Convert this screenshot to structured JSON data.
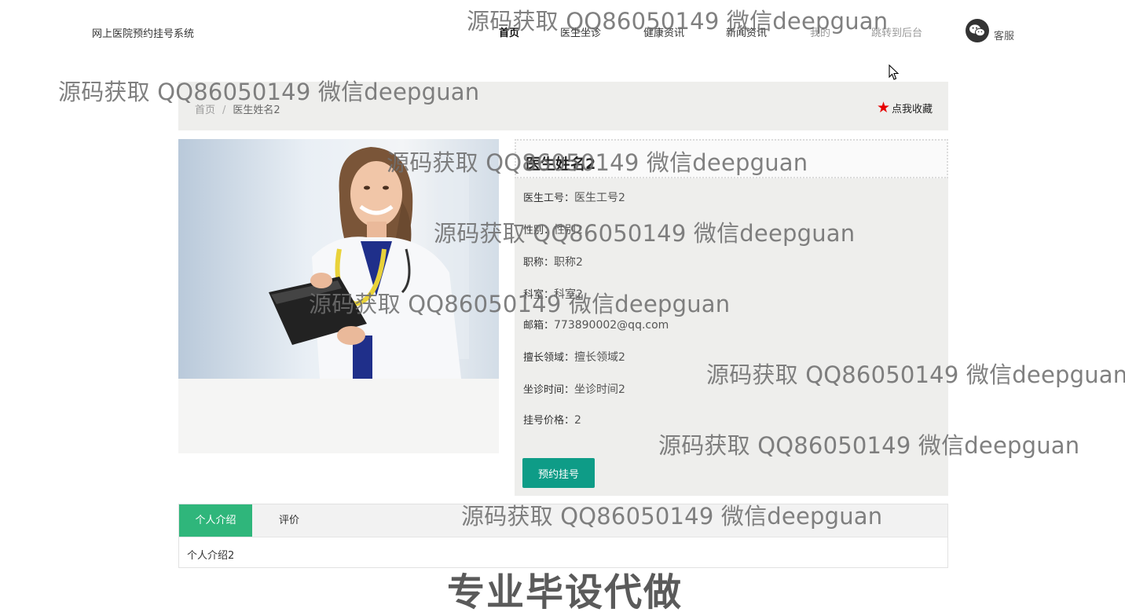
{
  "header": {
    "site_title": "网上医院预约挂号系统",
    "nav": [
      "首页",
      "医生坐诊",
      "健康资讯",
      "新闻资讯",
      "我的",
      "跳转到后台"
    ],
    "customer_service": "客服"
  },
  "breadcrumb": {
    "home": "首页",
    "separator": "/",
    "current": "医生姓名2"
  },
  "favorite_label": "点我收藏",
  "doctor": {
    "name": "医生姓名2",
    "fields": [
      {
        "label": "医生工号：",
        "value": "医生工号2"
      },
      {
        "label": "性别：",
        "value": "性别2"
      },
      {
        "label": "职称：",
        "value": "职称2"
      },
      {
        "label": "科室：",
        "value": "科室2"
      },
      {
        "label": "邮箱：",
        "value": "773890002@qq.com"
      },
      {
        "label": "擅长领域：",
        "value": "擅长领域2"
      },
      {
        "label": "坐诊时间：",
        "value": "坐诊时间2"
      },
      {
        "label": "挂号价格：",
        "value": "2"
      }
    ],
    "book_button": "预约挂号"
  },
  "tabs": {
    "items": [
      "个人介绍",
      "评价"
    ],
    "active_content": "个人介绍2"
  },
  "watermarks": {
    "text": "源码获取 QQ86050149 微信deepguan",
    "banner": "专业毕设代做"
  },
  "colors": {
    "accent_teal": "#0e9c87",
    "tab_green": "#2fb67b",
    "star_red": "#e60000"
  }
}
